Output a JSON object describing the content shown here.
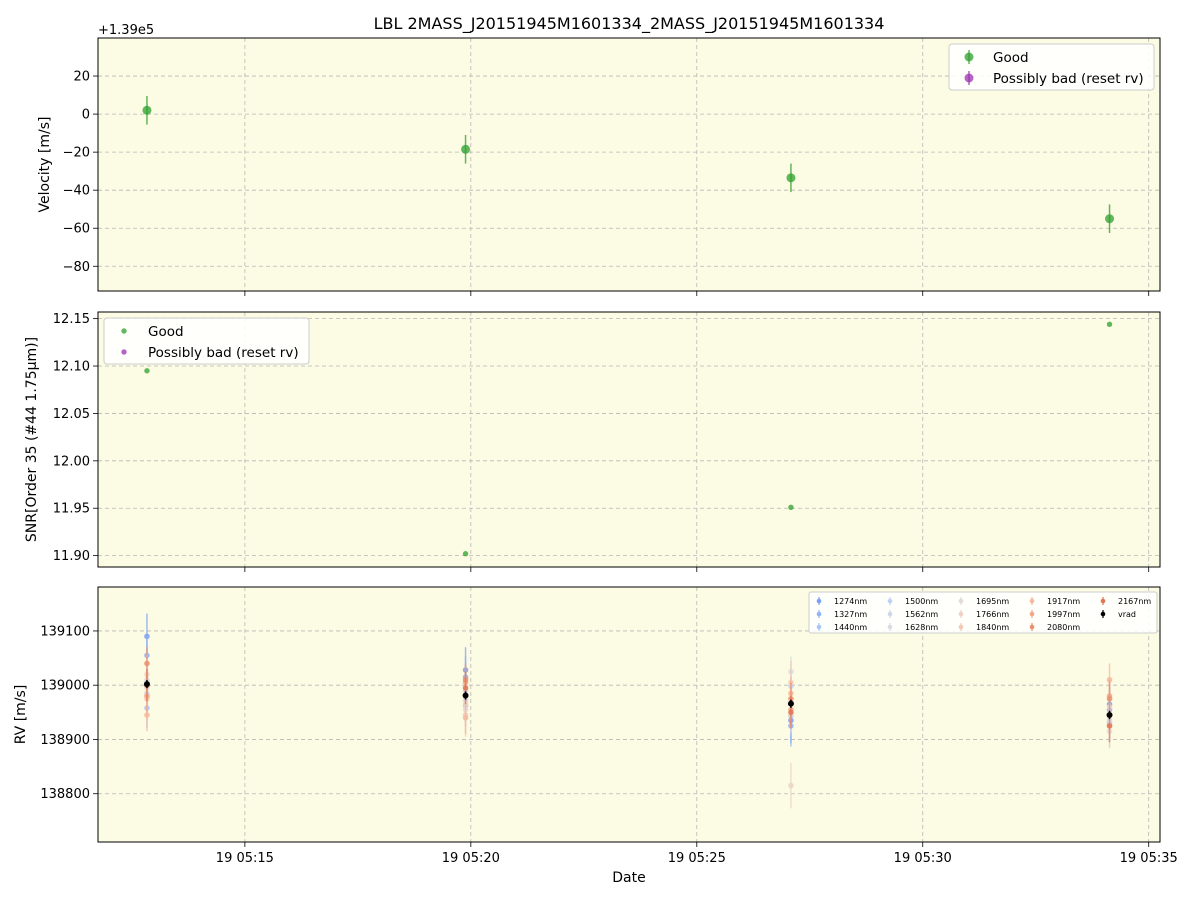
{
  "title": "LBL 2MASS_J20151945M1601334_2MASS_J20151945M1601334",
  "xlabel": "Date",
  "x_ticks": [
    "19 05:15",
    "19 05:20",
    "19 05:25",
    "19 05:30",
    "19 05:35"
  ],
  "colors": {
    "panel_bg": "#fcfbe3",
    "good": "#2ca02c",
    "bad": "#9b30b0",
    "vrad": "#000000"
  },
  "chart_data": [
    {
      "type": "scatter",
      "panel": "velocity",
      "ylabel": "Velocity [m/s]",
      "offset_text": "+1.39e5",
      "ylim": [
        -93,
        40
      ],
      "y_ticks": [
        "20",
        "0",
        "−20",
        "−40",
        "−60",
        "−80"
      ],
      "y_tick_values": [
        20,
        0,
        -20,
        -40,
        -60,
        -80
      ],
      "xlim": [
        "05:11:45",
        "05:35:15"
      ],
      "grid": true,
      "legend": {
        "placement": "top-right",
        "entries": [
          "Good",
          "Possibly bad (reset rv)"
        ]
      },
      "series": [
        {
          "name": "Good",
          "points": [
            {
              "x": "05:12:50",
              "y": 2,
              "err": 7.5
            },
            {
              "x": "05:19:53",
              "y": -18.5,
              "err": 7.5
            },
            {
              "x": "05:27:05",
              "y": -33.5,
              "err": 7.5
            },
            {
              "x": "05:34:08",
              "y": -55,
              "err": 7.5
            }
          ]
        },
        {
          "name": "Possibly bad (reset rv)",
          "points": []
        }
      ]
    },
    {
      "type": "scatter",
      "panel": "snr",
      "ylabel": "SNR[Order 35 (#44 1.75μm)]",
      "ylim": [
        11.888,
        12.157
      ],
      "y_ticks": [
        "12.15",
        "12.10",
        "12.05",
        "12.00",
        "11.95",
        "11.90"
      ],
      "y_tick_values": [
        12.15,
        12.1,
        12.05,
        12.0,
        11.95,
        11.9
      ],
      "xlim": [
        "05:11:45",
        "05:35:15"
      ],
      "grid": true,
      "legend": {
        "placement": "top-left",
        "entries": [
          "Good",
          "Possibly bad (reset rv)"
        ]
      },
      "series": [
        {
          "name": "Good",
          "points": [
            {
              "x": "05:12:50",
              "y": 12.095
            },
            {
              "x": "05:19:53",
              "y": 11.902
            },
            {
              "x": "05:27:05",
              "y": 11.951
            },
            {
              "x": "05:34:08",
              "y": 12.144
            }
          ]
        },
        {
          "name": "Possibly bad (reset rv)",
          "points": []
        }
      ]
    },
    {
      "type": "scatter",
      "panel": "rv",
      "ylabel": "RV [m/s]",
      "ylim": [
        138711,
        139181
      ],
      "y_ticks": [
        "139100",
        "139000",
        "138900",
        "138800"
      ],
      "y_tick_values": [
        139100,
        139000,
        138900,
        138800
      ],
      "xlim": [
        "05:11:45",
        "05:35:15"
      ],
      "x": [
        "05:12:50",
        "05:19:53",
        "05:27:05",
        "05:34:08"
      ],
      "grid": true,
      "legend": {
        "placement": "top-right",
        "columns": 5
      },
      "series": [
        {
          "name": "1274nm",
          "color": "#7b9ff2",
          "values": [
            139090,
            139028,
            138935,
            138965
          ],
          "err": 42
        },
        {
          "name": "1327nm",
          "color": "#90b2fa",
          "values": [
            139055,
            139015,
            138925,
            138955
          ],
          "err": 38
        },
        {
          "name": "1440nm",
          "color": "#a9c5fc",
          "values": [
            138958,
            138962,
            138943,
            138930
          ],
          "err": 36
        },
        {
          "name": "1500nm",
          "color": "#bed2f6",
          "values": [
            139005,
            138990,
            138998,
            138945
          ],
          "err": 30
        },
        {
          "name": "1562nm",
          "color": "#ccd7ec",
          "values": [
            138985,
            138972,
            138965,
            138935
          ],
          "err": 28
        },
        {
          "name": "1628nm",
          "color": "#d8dce2",
          "values": [
            139010,
            138980,
            139025,
            138960
          ],
          "err": 28
        },
        {
          "name": "1695nm",
          "color": "#e2dad5",
          "values": [
            138995,
            138955,
            138945,
            138915
          ],
          "err": 32
        },
        {
          "name": "1766nm",
          "color": "#ecd3c5",
          "values": [
            139020,
            138965,
            138815,
            138945
          ],
          "err": 42
        },
        {
          "name": "1840nm",
          "color": "#f3c8b4",
          "values": [
            138975,
            138945,
            139005,
            138925
          ],
          "err": 40
        },
        {
          "name": "1917nm",
          "color": "#f5b89e",
          "values": [
            138945,
            138940,
            138985,
            139010
          ],
          "err": 30
        },
        {
          "name": "1997nm",
          "color": "#f3a586",
          "values": [
            138980,
            139005,
            138955,
            138980
          ],
          "err": 30
        },
        {
          "name": "2080nm",
          "color": "#eb8f6d",
          "values": [
            139040,
            139010,
            138975,
            138975
          ],
          "err": 30
        },
        {
          "name": "2167nm",
          "color": "#e07656",
          "values": [
            139000,
            138995,
            138950,
            138925
          ],
          "err": 30
        },
        {
          "name": "vrad",
          "color": "#000000",
          "values": [
            139002,
            138981,
            138966,
            138945
          ],
          "err": 7.5
        }
      ]
    }
  ]
}
